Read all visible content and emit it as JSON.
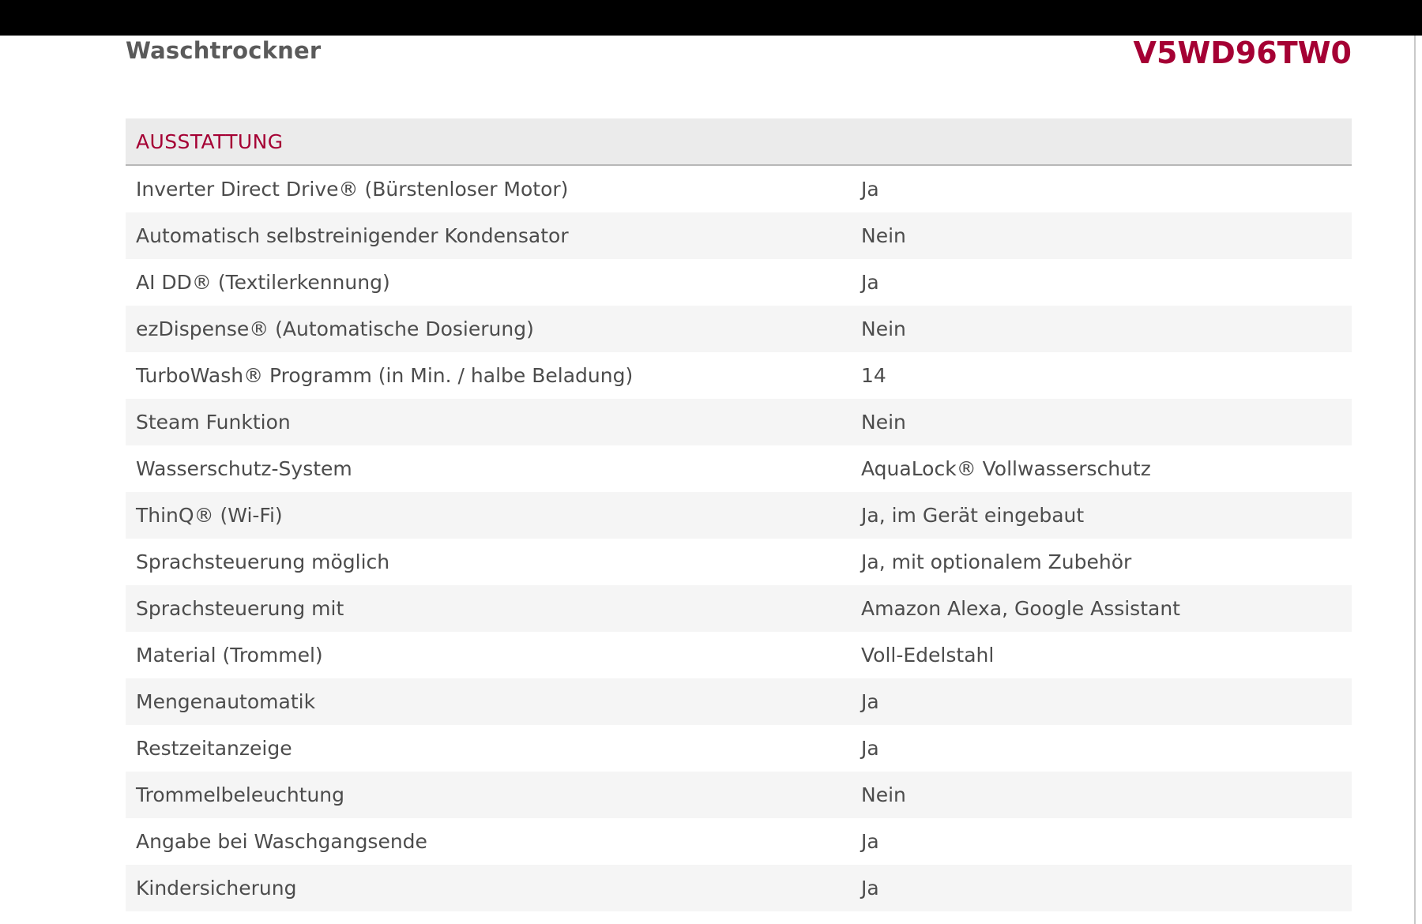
{
  "header": {
    "category": "Waschtrockner",
    "model": "V5WD96TW0"
  },
  "section": {
    "title": "AUSSTATTUNG"
  },
  "rows": [
    {
      "label": "Inverter Direct Drive® (Bürstenloser Motor)",
      "value": "Ja"
    },
    {
      "label": "Automatisch selbstreinigender Kondensator",
      "value": "Nein"
    },
    {
      "label": "AI DD® (Textilerkennung)",
      "value": "Ja"
    },
    {
      "label": "ezDispense® (Automatische Dosierung)",
      "value": "Nein"
    },
    {
      "label": "TurboWash® Programm (in Min. / halbe Beladung)",
      "value": "14"
    },
    {
      "label": "Steam Funktion",
      "value": "Nein"
    },
    {
      "label": "Wasserschutz-System",
      "value": "AquaLock® Vollwasserschutz"
    },
    {
      "label": "ThinQ® (Wi-Fi)",
      "value": "Ja, im Gerät eingebaut"
    },
    {
      "label": "Sprachsteuerung möglich",
      "value": "Ja, mit optionalem Zubehör"
    },
    {
      "label": "Sprachsteuerung mit",
      "value": "Amazon Alexa, Google Assistant"
    },
    {
      "label": "Material (Trommel)",
      "value": "Voll-Edelstahl"
    },
    {
      "label": "Mengenautomatik",
      "value": "Ja"
    },
    {
      "label": "Restzeitanzeige",
      "value": "Ja"
    },
    {
      "label": "Trommelbeleuchtung",
      "value": "Nein"
    },
    {
      "label": "Angabe bei Waschgangsende",
      "value": "Ja"
    },
    {
      "label": "Kindersicherung",
      "value": "Ja"
    }
  ],
  "colors": {
    "accent": "#a50034",
    "header_row_bg": "#ebebeb",
    "stripe_bg": "#f5f5f5",
    "text": "#4c4c4c"
  }
}
